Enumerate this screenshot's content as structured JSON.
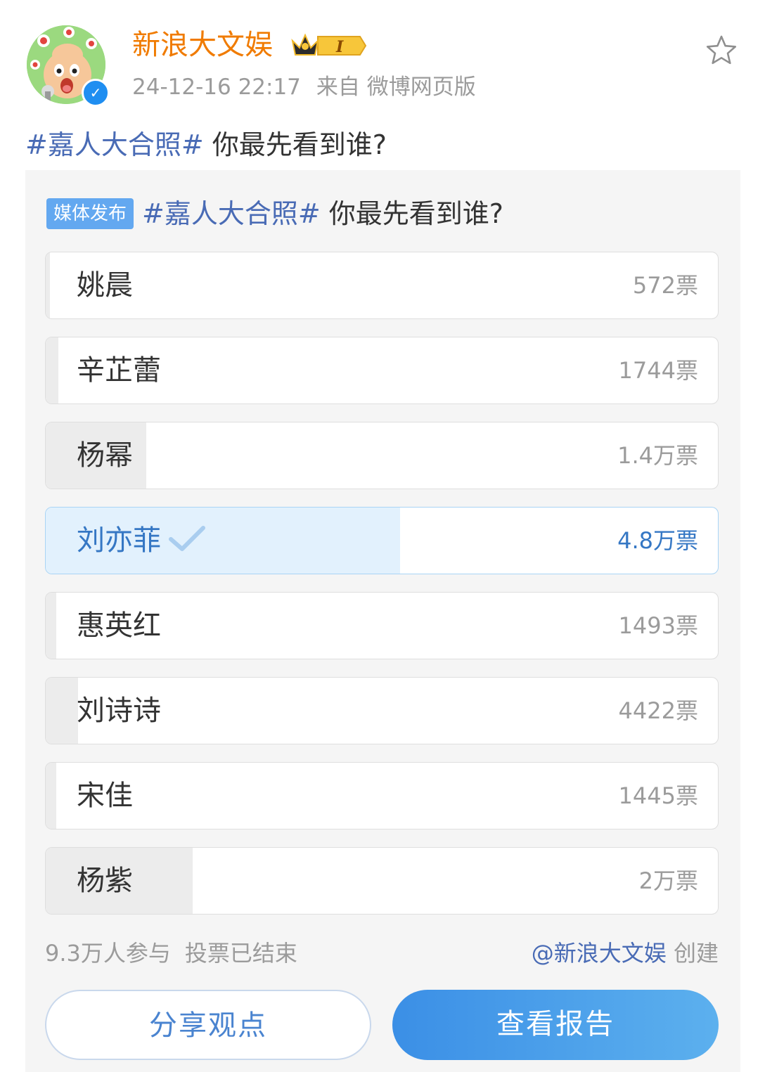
{
  "post": {
    "username": "新浪大文娱",
    "vip_level": "I",
    "timestamp": "24-12-16 22:17",
    "source": "来自 微博网页版",
    "hashtag": "#嘉人大合照#",
    "text": " 你最先看到谁?"
  },
  "vote": {
    "tag": "媒体发布",
    "hashtag": "#嘉人大合照#",
    "question": " 你最先看到谁?",
    "options": [
      {
        "name": "姚晨",
        "votes": "572票",
        "share": 0.006,
        "selected": false
      },
      {
        "name": "辛芷蕾",
        "votes": "1744票",
        "share": 0.019,
        "selected": false
      },
      {
        "name": "杨幂",
        "votes": "1.4万票",
        "share": 0.15,
        "selected": false
      },
      {
        "name": "刘亦菲",
        "votes": "4.8万票",
        "share": 0.527,
        "selected": true
      },
      {
        "name": "惠英红",
        "votes": "1493票",
        "share": 0.016,
        "selected": false
      },
      {
        "name": "刘诗诗",
        "votes": "4422票",
        "share": 0.048,
        "selected": false
      },
      {
        "name": "宋佳",
        "votes": "1445票",
        "share": 0.016,
        "selected": false
      },
      {
        "name": "杨紫",
        "votes": "2万票",
        "share": 0.219,
        "selected": false
      }
    ],
    "participants": "9.3万人参与",
    "status": "投票已结束",
    "creator_link": "@新浪大文娱",
    "creator_suffix": " 创建",
    "share_button": "分享观点",
    "report_button": "查看报告"
  },
  "colors": {
    "username": "#f07b00",
    "hashtag": "#496bb5",
    "selected": "#3577c4",
    "button_gradient_start": "#3b8fe6",
    "button_gradient_end": "#5cb0ee"
  },
  "icons": {
    "star": "star-outline-icon",
    "verified": "verified-v-icon",
    "vip": "crown-vip-badge-icon",
    "check": "check-icon"
  }
}
